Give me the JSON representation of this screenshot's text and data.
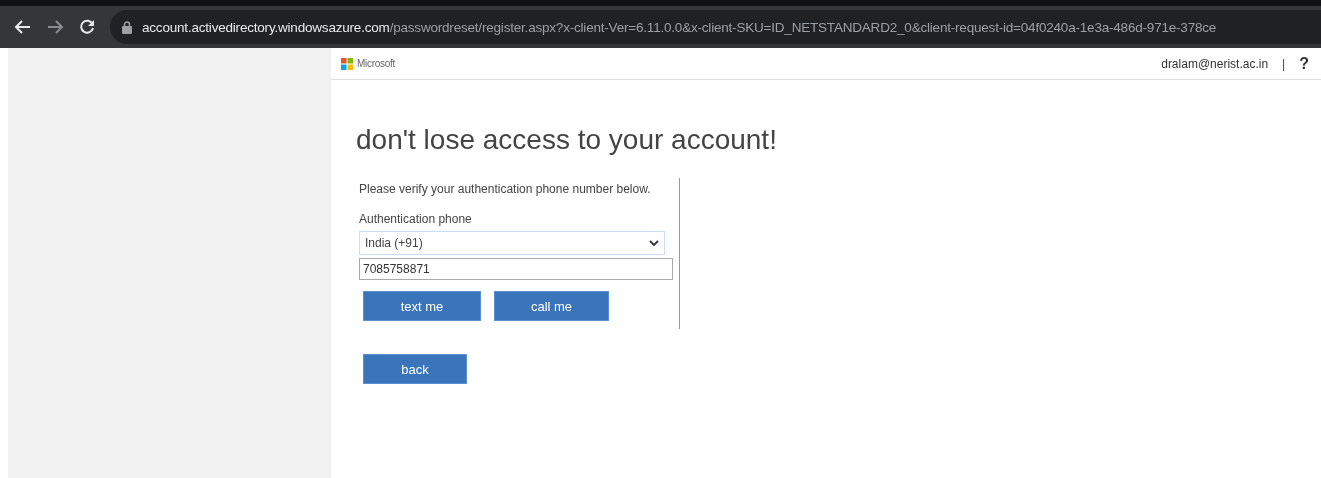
{
  "browser": {
    "url_host": "account.activedirectory.windowsazure.com",
    "url_path": "/passwordreset/register.aspx?x-client-Ver=6.11.0.0&x-client-SKU=ID_NETSTANDARD2_0&client-request-id=04f0240a-1e3a-486d-971e-378ce"
  },
  "header": {
    "brand": "Microsoft",
    "user": "dralam@nerist.ac.in",
    "separator": "|",
    "help": "?"
  },
  "title": "don't lose access to your account!",
  "form": {
    "instruction": "Please verify your authentication phone number below.",
    "label": "Authentication phone",
    "country": "India (+91)",
    "phone": "7085758871",
    "buttons": [
      "text me",
      "call me"
    ]
  },
  "back": "back"
}
